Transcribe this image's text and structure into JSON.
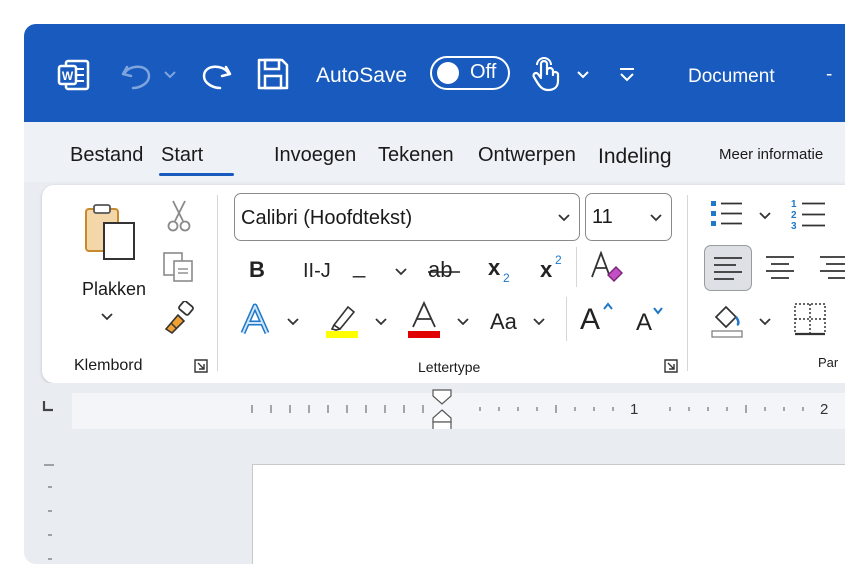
{
  "titlebar": {
    "autosave_label": "AutoSave",
    "autosave_state": "Off",
    "document_name": "Document",
    "minimize": "-"
  },
  "tabs": [
    "Bestand",
    "Start",
    "Invoegen",
    "Tekenen",
    "Ontwerpen",
    "Indeling"
  ],
  "active_tab": "Start",
  "more_info": "Meer informatie",
  "clipboard": {
    "paste_label": "Plakken",
    "group_label": "Klembord"
  },
  "font": {
    "font_name": "Calibri (Hoofdtekst)",
    "font_size": "11",
    "bold": "B",
    "italic_label": "II-J",
    "underline": "_",
    "strike": "ab",
    "subscript": "x",
    "subscript_sup": "2",
    "superscript": "x",
    "superscript_sup": "2",
    "change_case": "Aa",
    "grow": "A",
    "shrink": "A",
    "group_label": "Lettertype"
  },
  "paragraph": {
    "group_label": "Par"
  },
  "ruler": {
    "mark_1": "1",
    "mark_2": "2"
  },
  "colors": {
    "brand": "#185abd",
    "highlight": "#ffff00",
    "font_color": "#e00000"
  }
}
